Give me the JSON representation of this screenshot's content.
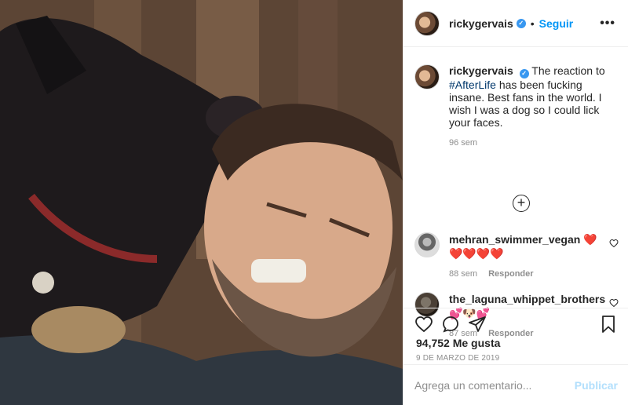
{
  "header": {
    "username": "rickygervais",
    "verified_mark": "✓",
    "separator": "•",
    "follow_label": "Seguir",
    "more_label": "•••"
  },
  "caption": {
    "username": "rickygervais",
    "verified_mark": "✓",
    "text_before": " The reaction to ",
    "hashtag": "#AfterLife",
    "text_after": " has been fucking insane. Best fans in the world. I wish I was a dog so I could lick your faces.",
    "time": "96 sem"
  },
  "load_more_label": "+",
  "comments": [
    {
      "username": "mehran_swimmer_vegan",
      "emoji": "❤️❤️❤️❤️❤️",
      "time": "88 sem",
      "reply_label": "Responder",
      "like_icon": "heart-outline-icon"
    },
    {
      "username": "the_laguna_whippet_brothers",
      "emoji": "💕🐶💕",
      "time": "87 sem",
      "reply_label": "Responder",
      "like_icon": "heart-outline-icon"
    }
  ],
  "actions": {
    "icons": [
      "heart-icon",
      "comment-icon",
      "share-icon",
      "bookmark-icon"
    ],
    "likes": "94,752 Me gusta",
    "date": "9 DE MARZO DE 2019"
  },
  "add_comment": {
    "placeholder": "Agrega un comentario...",
    "publish_label": "Publicar"
  },
  "colors": {
    "accent": "#0095f6",
    "publish_disabled": "#b2dffc",
    "muted": "#8e8e8e",
    "verified": "#3897f0"
  }
}
